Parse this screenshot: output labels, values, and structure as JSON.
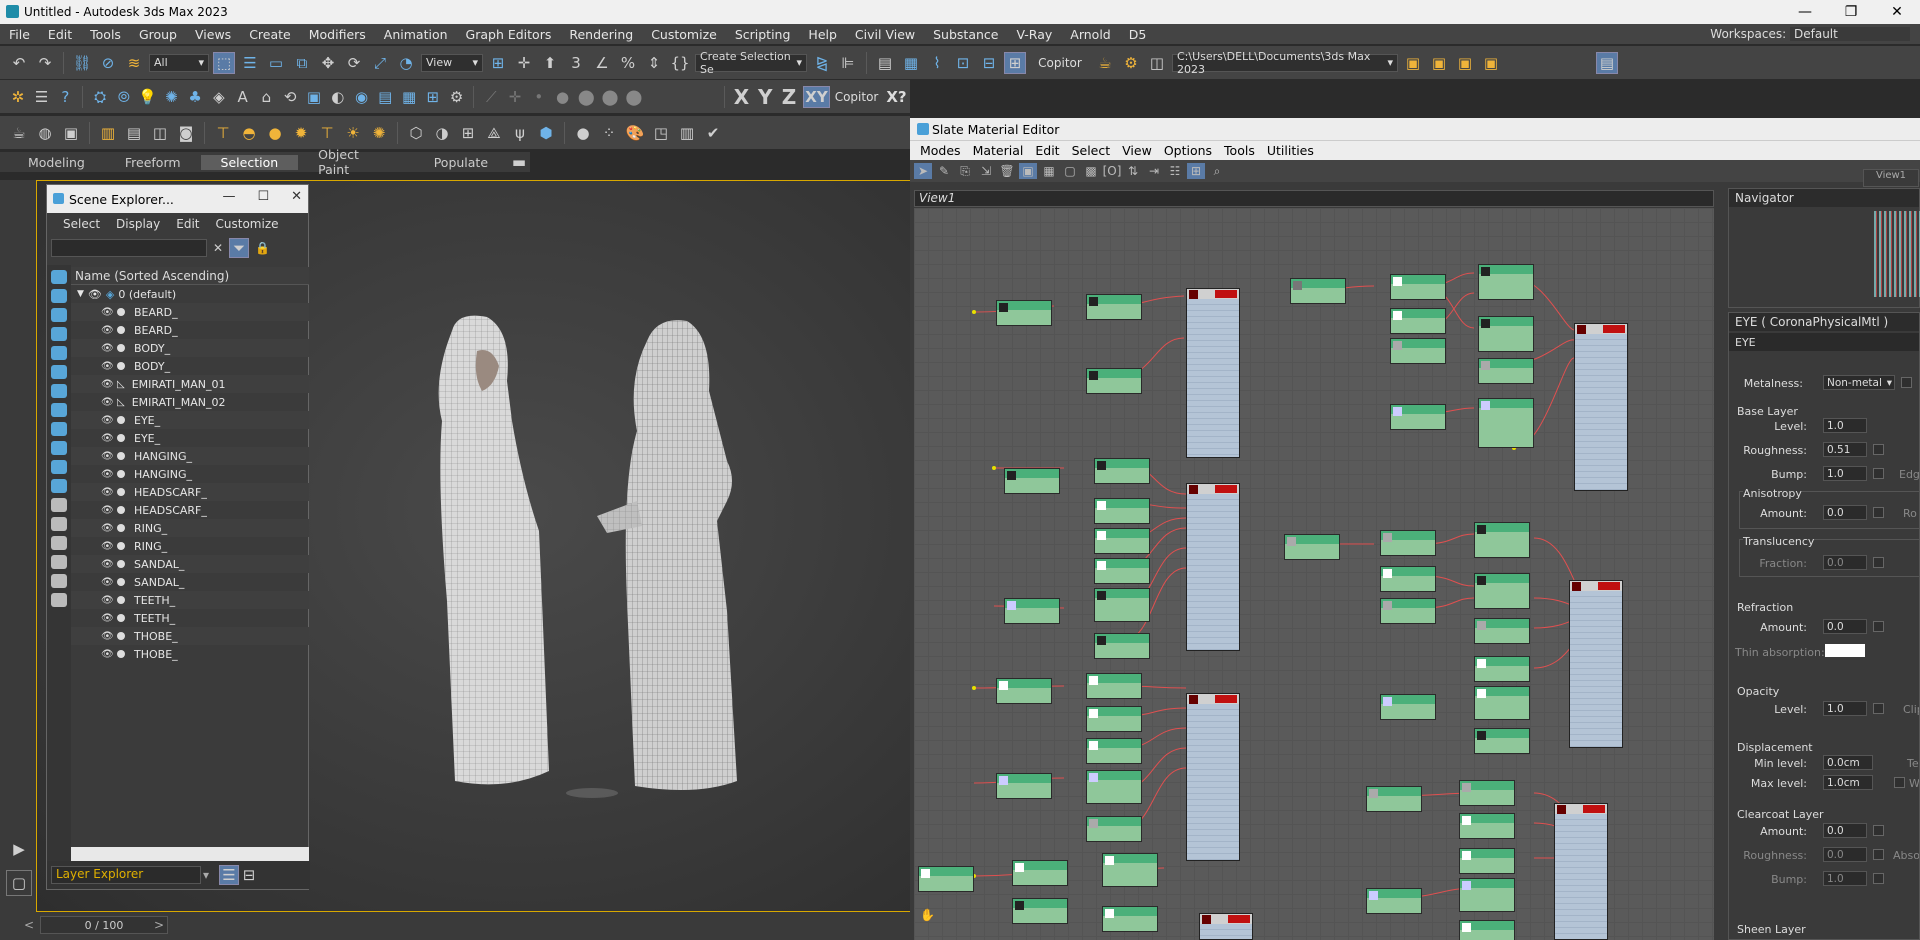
{
  "window": {
    "title": "Untitled - Autodesk 3ds Max 2023",
    "minimize": "—",
    "maximize": "❐",
    "close": "✕"
  },
  "menu": [
    "File",
    "Edit",
    "Tools",
    "Group",
    "Views",
    "Create",
    "Modifiers",
    "Animation",
    "Graph Editors",
    "Rendering",
    "Customize",
    "Scripting",
    "Help",
    "Civil View",
    "Substance",
    "V-Ray",
    "Arnold",
    "D5"
  ],
  "workspaces": {
    "label": "Workspaces:",
    "value": "Default"
  },
  "toolbar": {
    "filter": "All",
    "view": "View",
    "create_selection_set": "Create Selection Se",
    "copitor": "Copitor",
    "project_path": "C:\\Users\\DELL\\Documents\\3ds Max 2023",
    "axis_x": "X",
    "axis_y": "Y",
    "axis_z": "Z",
    "axis_xy": "XY",
    "copitor2": "Copitor",
    "xq": "X?"
  },
  "ribbon": {
    "tabs": [
      "Modeling",
      "Freeform",
      "Selection",
      "Object Paint",
      "Populate"
    ],
    "selected": "Selection"
  },
  "scene_explorer": {
    "title": "Scene Explorer...",
    "menu": [
      "Select",
      "Display",
      "Edit",
      "Customize"
    ],
    "column": "Name (Sorted Ascending)",
    "root": "0 (default)",
    "items": [
      "BEARD_",
      "BEARD_",
      "BODY_",
      "BODY_",
      "EMIRATI_MAN_01",
      "EMIRATI_MAN_02",
      "EYE_",
      "EYE_",
      "HANGING_",
      "HANGING_",
      "HEADSCARF_",
      "HEADSCARF_",
      "RING_",
      "RING_",
      "SANDAL_",
      "SANDAL_",
      "TEETH_",
      "TEETH_",
      "THOBE_",
      "THOBE_"
    ],
    "layer_explorer": "Layer Explorer"
  },
  "timeline": {
    "frame": "0 / 100"
  },
  "slate": {
    "title": "Slate Material Editor",
    "menu": [
      "Modes",
      "Material",
      "Edit",
      "Select",
      "View",
      "Options",
      "Tools",
      "Utilities"
    ],
    "view_tab": "View1",
    "view_label": "View1",
    "navigator": "Navigator"
  },
  "material": {
    "header": "EYE  ( CoronaPhysicalMtl )",
    "name": "EYE",
    "metalness_label": "Metalness:",
    "metalness_value": "Non-metal",
    "base_layer": "Base Layer",
    "level_label": "Level:",
    "level_value": "1.0",
    "roughness_label": "Roughness:",
    "roughness_value": "0.51",
    "bump_label": "Bump:",
    "bump_value": "1.0",
    "edge": "Edge",
    "anisotropy": "Anisotropy",
    "amount_label": "Amount:",
    "anis_amount": "0.0",
    "ro": "Ro",
    "translucency": "Translucency",
    "fraction_label": "Fraction:",
    "fraction_value": "0.0",
    "refraction": "Refraction",
    "refr_amount": "0.0",
    "thin_absorption": "Thin absorption:",
    "opacity": "Opacity",
    "opacity_level": "1.0",
    "clip": "Clip",
    "displacement": "Displacement",
    "min_level_label": "Min level:",
    "min_level": "0.0cm",
    "te": "Te",
    "max_level_label": "Max level:",
    "max_level": "1.0cm",
    "w": "W",
    "clearcoat": "Clearcoat Layer",
    "cc_amount": "0.0",
    "cc_roughness_label": "Roughness:",
    "cc_roughness": "0.0",
    "abso": "Abso",
    "cc_bump_label": "Bump:",
    "cc_bump": "1.0",
    "sheen": "Sheen Layer"
  }
}
